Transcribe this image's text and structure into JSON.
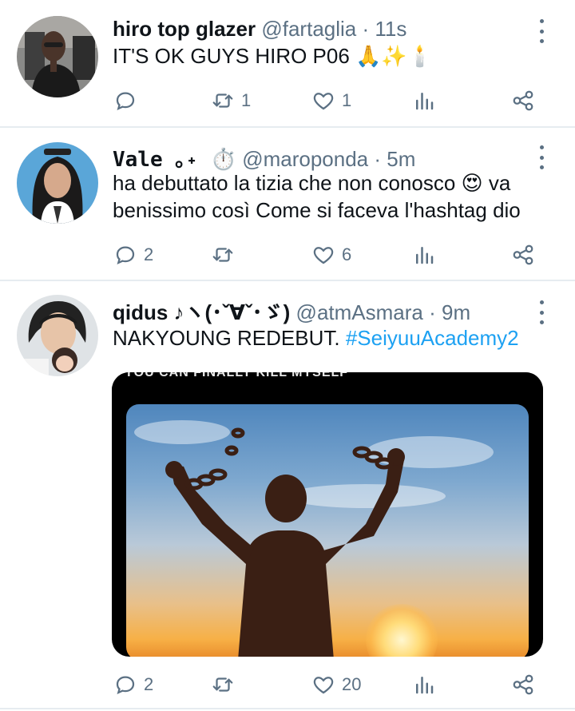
{
  "tweets": [
    {
      "name": "hiro top glazer",
      "handle": "@fartaglia",
      "sep": "·",
      "time": "11s",
      "text": "IT'S OK GUYS HIRO P06 🙏✨🕯️",
      "reply_count": "",
      "retweet_count": "1",
      "like_count": "1"
    },
    {
      "name": "Vale ｡˖ ⏱️",
      "handle": "@maroponda",
      "sep": "·",
      "time": "5m",
      "text": "ha debuttato la tizia che non conosco 😍 va benissimo così Come si faceva l'hashtag dio",
      "reply_count": "2",
      "retweet_count": "",
      "like_count": "6"
    },
    {
      "name": "qidus ♪ヽ(･ˇ∀ˇ･ゞ)",
      "handle": "@atmAsmara",
      "sep": "·",
      "time": "9m",
      "text": "NAKYOUNG REDEBUT. ",
      "hashtag": "#SeiyuuAcademy2",
      "media_caption": "YOU CAN FINALLY KILL MYSELF",
      "reply_count": "2",
      "retweet_count": "",
      "like_count": "20"
    }
  ],
  "icons": {
    "reply": "reply-icon",
    "retweet": "retweet-icon",
    "like": "heart-icon",
    "stats": "analytics-icon",
    "share": "share-icon",
    "more": "more-vertical-icon"
  },
  "colors": {
    "text": "#0f1419",
    "muted": "#5b7083",
    "link": "#1da1f2",
    "divider": "#e6ecf0"
  }
}
